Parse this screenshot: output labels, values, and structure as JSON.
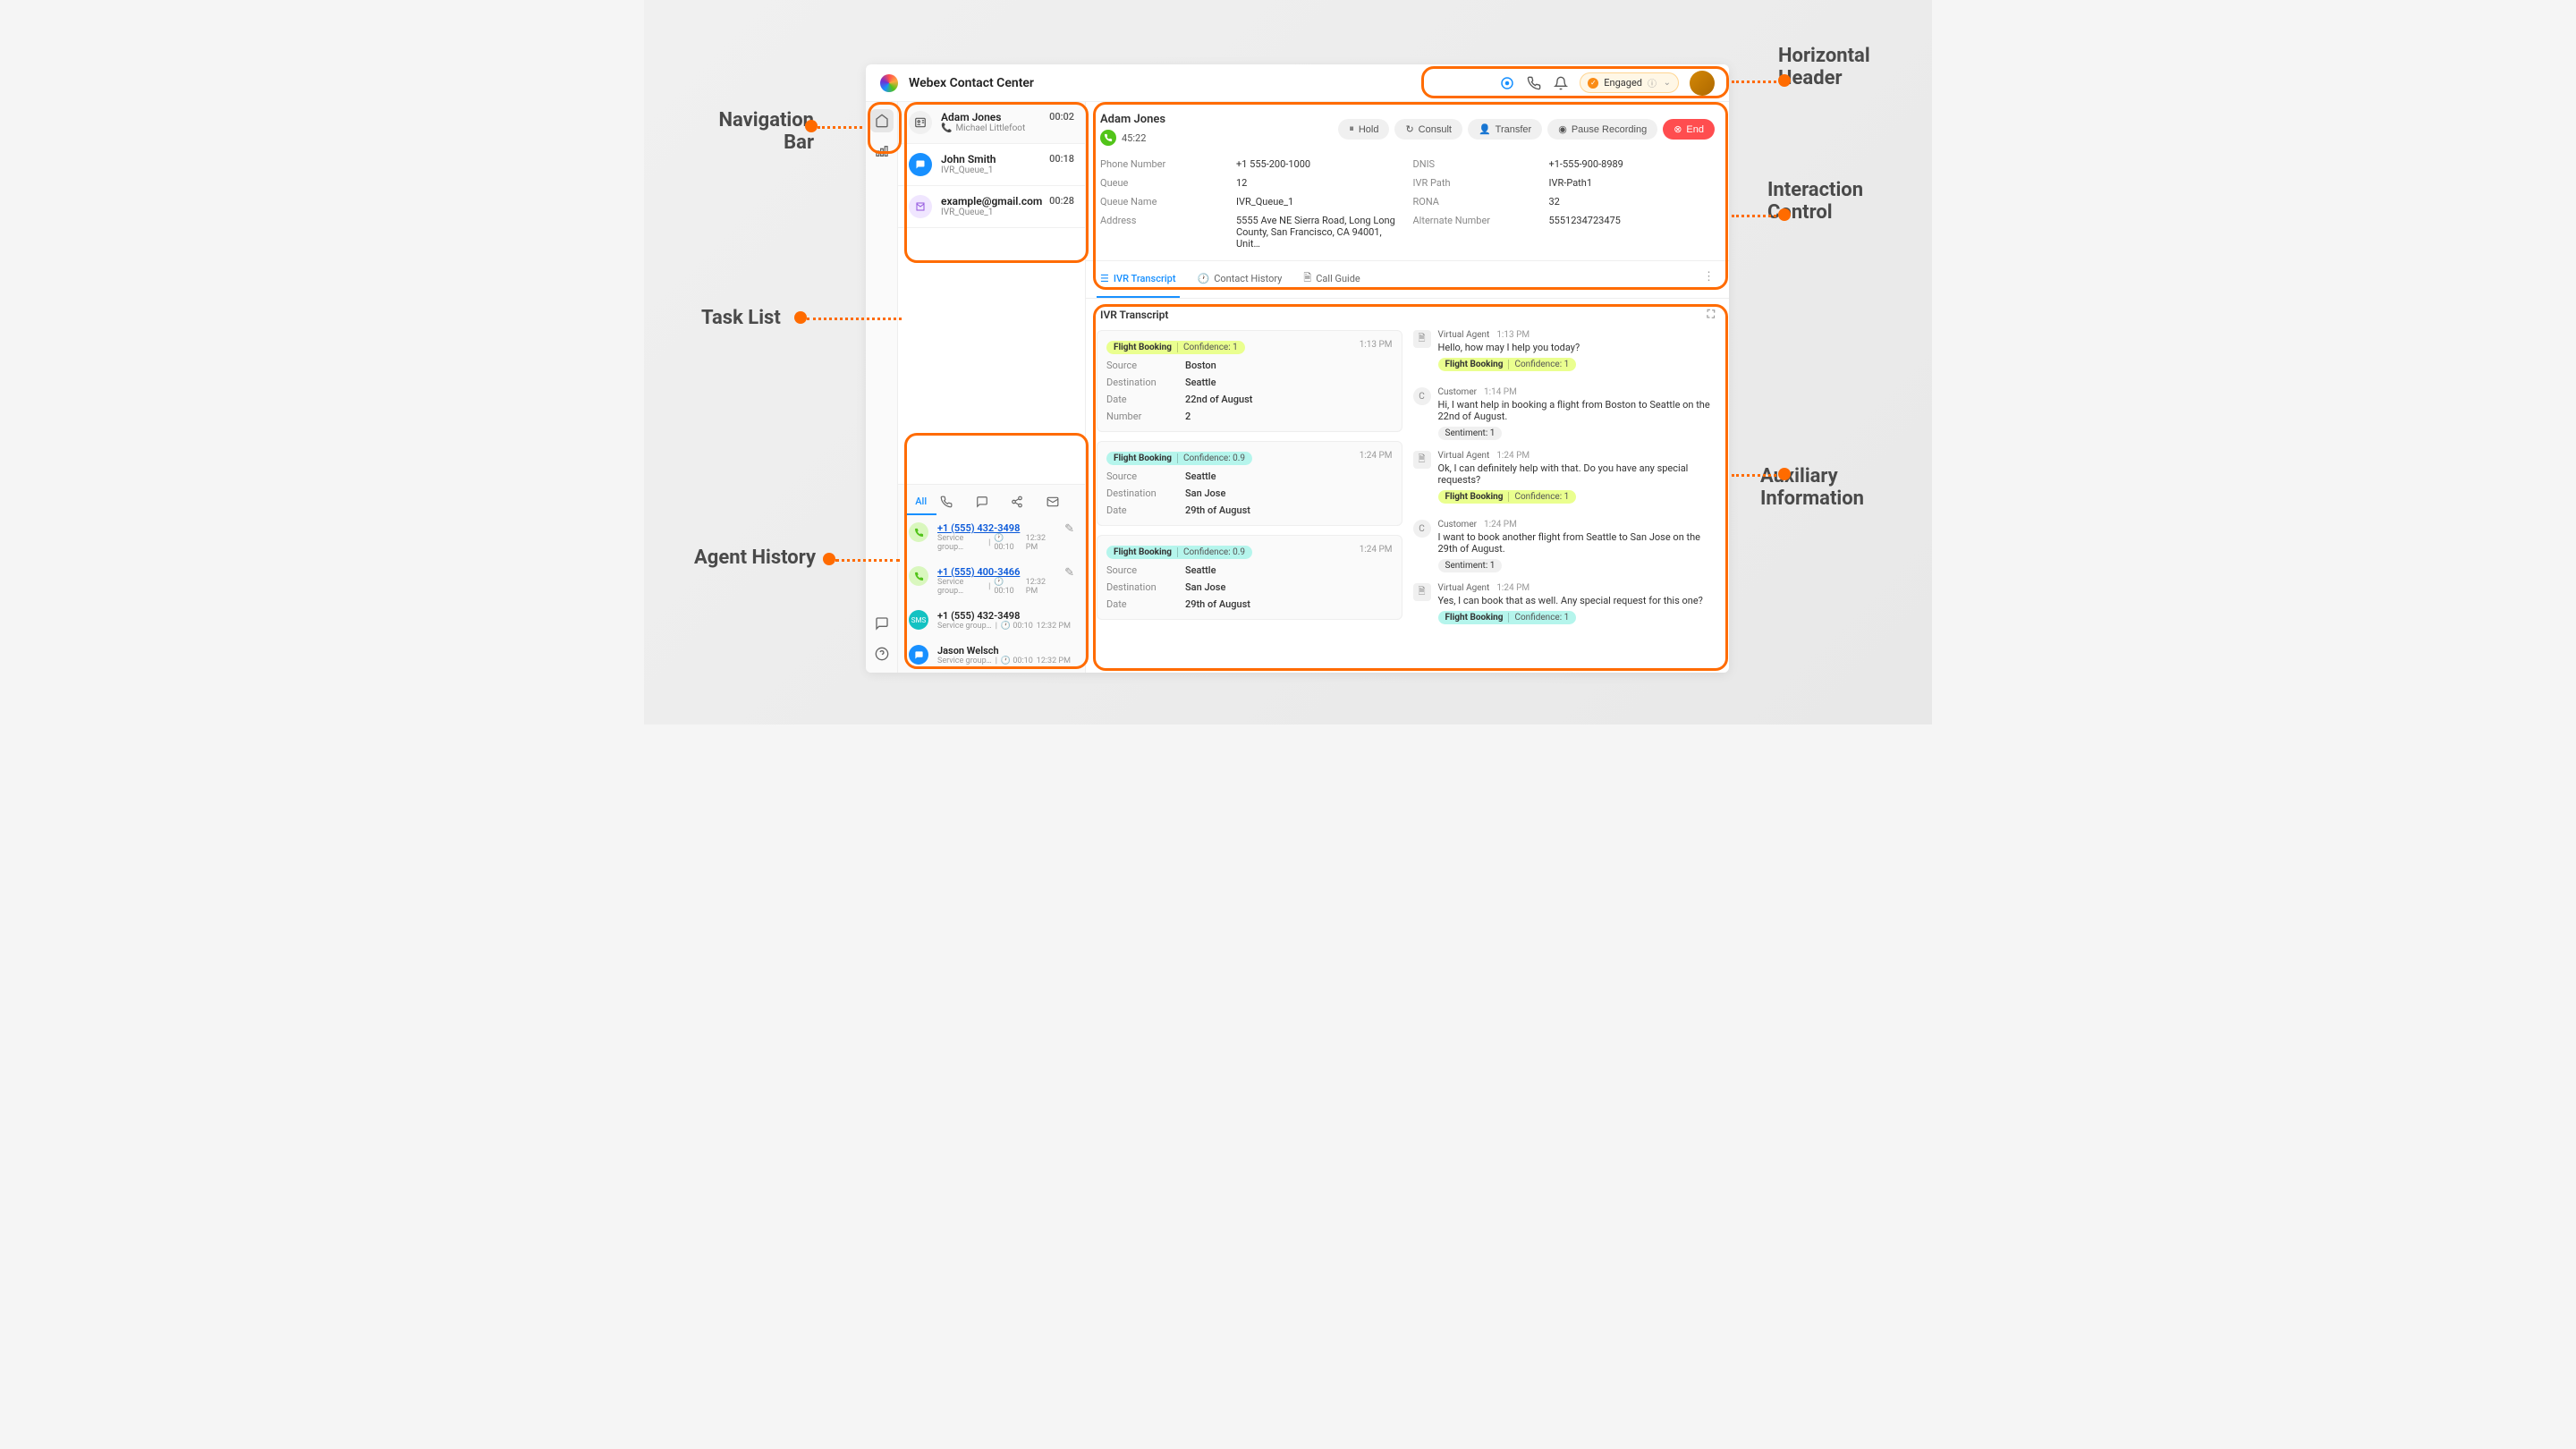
{
  "header": {
    "app_title": "Webex Contact Center",
    "status_label": "Engaged"
  },
  "tasks": [
    {
      "name": "Adam Jones",
      "sub": "Michael Littlefoot",
      "time": "00:02"
    },
    {
      "name": "John Smith",
      "sub": "IVR_Queue_1",
      "time": "00:18"
    },
    {
      "name": "example@gmail.com",
      "sub": "IVR_Queue_1",
      "time": "00:28"
    }
  ],
  "history_tabs": {
    "all": "All"
  },
  "history": [
    {
      "title": "+1 (555) 432-3498",
      "sub1": "Service group…",
      "dur": "00:10",
      "time": "12:32 PM",
      "link": true,
      "edit": true
    },
    {
      "title": "+1 (555) 400-3466",
      "sub1": "Service group…",
      "dur": "00:10",
      "time": "12:32 PM",
      "link": true,
      "edit": true
    },
    {
      "title": "+1 (555) 432-3498",
      "sub1": "Service group…",
      "dur": "00:10",
      "time": "12:32 PM",
      "link": false
    },
    {
      "title": "Jason Welsch",
      "sub1": "Service group…",
      "dur": "00:10",
      "time": "12:32 PM",
      "link": false
    }
  ],
  "interaction": {
    "name": "Adam Jones",
    "timer": "45:22",
    "buttons": {
      "hold": "Hold",
      "consult": "Consult",
      "transfer": "Transfer",
      "pause": "Pause Recording",
      "end": "End"
    },
    "fields": {
      "phone_label": "Phone Number",
      "phone_value": "+1 555-200-1000",
      "dnis_label": "DNIS",
      "dnis_value": "+1-555-900-8989",
      "queue_label": "Queue",
      "queue_value": "12",
      "ivrpath_label": "IVR Path",
      "ivrpath_value": "IVR-Path1",
      "qname_label": "Queue Name",
      "qname_value": "IVR_Queue_1",
      "rona_label": "RONA",
      "rona_value": "32",
      "addr_label": "Address",
      "addr_value": "5555 Ave NE Sierra Road, Long Long County, San Francisco, CA 94001, Unit…",
      "alt_label": "Alternate Number",
      "alt_value": "5551234723475"
    }
  },
  "aux": {
    "tabs": {
      "ivr": "IVR Transcript",
      "contact": "Contact History",
      "guide": "Call Guide"
    },
    "title": "IVR Transcript",
    "cards": [
      {
        "tag": "Flight Booking",
        "conf": "Confidence: 1",
        "tagcolor": "lime",
        "time": "1:13 PM",
        "src_l": "Source",
        "src": "Boston",
        "dst_l": "Destination",
        "dst": "Seattle",
        "dt_l": "Date",
        "dt": "22nd of August",
        "num_l": "Number",
        "num": "2"
      },
      {
        "tag": "Flight Booking",
        "conf": "Confidence: 0.9",
        "tagcolor": "cyan",
        "time": "1:24 PM",
        "src_l": "Source",
        "src": "Seattle",
        "dst_l": "Destination",
        "dst": "San Jose",
        "dt_l": "Date",
        "dt": "29th of August"
      },
      {
        "tag": "Flight Booking",
        "conf": "Confidence: 0.9",
        "tagcolor": "cyan",
        "time": "1:24 PM",
        "src_l": "Source",
        "src": "Seattle",
        "dst_l": "Destination",
        "dst": "San Jose",
        "dt_l": "Date",
        "dt": "29th of August"
      }
    ],
    "msgs": [
      {
        "role": "Virtual Agent",
        "time": "1:13 PM",
        "text": "Hello, how may I help you today?",
        "tag": "Flight Booking",
        "conf": "Confidence: 1",
        "tagcolor": "lime",
        "icon": "va"
      },
      {
        "role": "Customer",
        "time": "1:14 PM",
        "text": "Hi, I want help in booking a flight from Boston to Seattle on the 22nd of August.",
        "sent": "Sentiment: 1",
        "icon": "cust"
      },
      {
        "role": "Virtual Agent",
        "time": "1:24 PM",
        "text": "Ok, I can definitely help with that. Do you have any special requests?",
        "tag": "Flight Booking",
        "conf": "Confidence: 1",
        "tagcolor": "lime",
        "icon": "va"
      },
      {
        "role": "Customer",
        "time": "1:24 PM",
        "text": "I want to book another flight from Seattle to San Jose on the 29th of August.",
        "sent": "Sentiment: 1",
        "icon": "cust"
      },
      {
        "role": "Virtual Agent",
        "time": "1:24 PM",
        "text": "Yes, I can book that as well. Any special request for this one?",
        "tag": "Flight Booking",
        "conf": "Confidence: 1",
        "tagcolor": "cyan",
        "icon": "va"
      }
    ]
  },
  "labels": {
    "nav": "Navigation Bar",
    "hdr": "Horizontal Header",
    "task": "Task List",
    "int": "Interaction Control",
    "hist": "Agent History",
    "aux": "Auxiliary Information"
  }
}
